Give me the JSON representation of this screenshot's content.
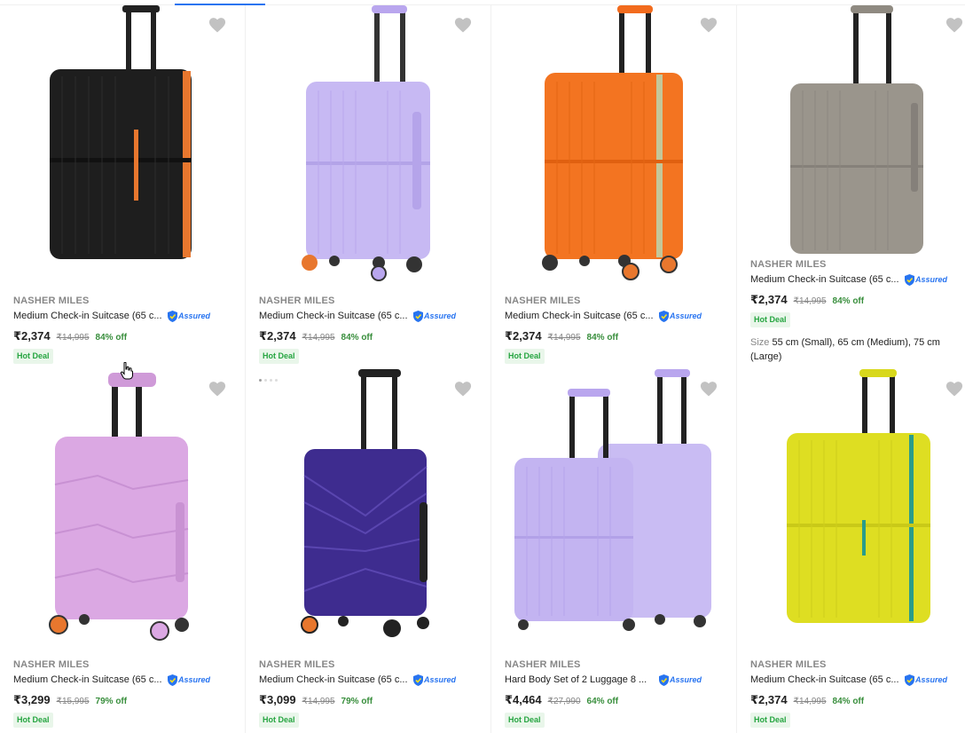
{
  "colors": {
    "accent": "#2874f0",
    "discount": "#388e3c",
    "deal_bg": "#e9f6ea",
    "deal_text": "#26a541",
    "muted": "#878787"
  },
  "assured_label": "Assured",
  "products": [
    {
      "brand": "NASHER MILES",
      "title": "Medium Check-in Suitcase (65 c...",
      "price": "₹2,374",
      "mrp": "₹14,995",
      "discount": "84% off",
      "badge": "Hot Deal",
      "image_color": "black-orange",
      "wishlist_icon": "heart-icon"
    },
    {
      "brand": "NASHER MILES",
      "title": "Medium Check-in Suitcase (65 c...",
      "price": "₹2,374",
      "mrp": "₹14,995",
      "discount": "84% off",
      "badge": "Hot Deal",
      "image_color": "lavender",
      "wishlist_icon": "heart-icon"
    },
    {
      "brand": "NASHER MILES",
      "title": "Medium Check-in Suitcase (65 c...",
      "price": "₹2,374",
      "mrp": "₹14,995",
      "discount": "84% off",
      "badge": "Hot Deal",
      "image_color": "orange",
      "wishlist_icon": "heart-icon"
    },
    {
      "brand": "NASHER MILES",
      "title": "Medium Check-in Suitcase (65 c...",
      "price": "₹2,374",
      "mrp": "₹14,995",
      "discount": "84% off",
      "badge": "Hot Deal",
      "size_label": "Size",
      "size_value": "55 cm (Small), 65 cm (Medium), 75 cm (Large)",
      "image_color": "grey",
      "wishlist_icon": "heart-icon"
    },
    {
      "brand": "NASHER MILES",
      "title": "Medium Check-in Suitcase (65 c...",
      "price": "₹3,299",
      "mrp": "₹15,995",
      "discount": "79% off",
      "badge": "Hot Deal",
      "image_color": "pink",
      "wishlist_icon": "heart-icon"
    },
    {
      "brand": "NASHER MILES",
      "title": "Medium Check-in Suitcase (65 c...",
      "price": "₹3,099",
      "mrp": "₹14,995",
      "discount": "79% off",
      "badge": "Hot Deal",
      "image_color": "purple",
      "wishlist_icon": "heart-icon"
    },
    {
      "brand": "NASHER MILES",
      "title": "Hard Body Set of 2 Luggage 8 ...",
      "price": "₹4,464",
      "mrp": "₹27,990",
      "discount": "64% off",
      "badge": "Hot Deal",
      "image_color": "lavender-set",
      "wishlist_icon": "heart-icon"
    },
    {
      "brand": "NASHER MILES",
      "title": "Medium Check-in Suitcase (65 c...",
      "price": "₹2,374",
      "mrp": "₹14,995",
      "discount": "84% off",
      "badge": "Hot Deal",
      "image_color": "yellow",
      "wishlist_icon": "heart-icon"
    }
  ]
}
